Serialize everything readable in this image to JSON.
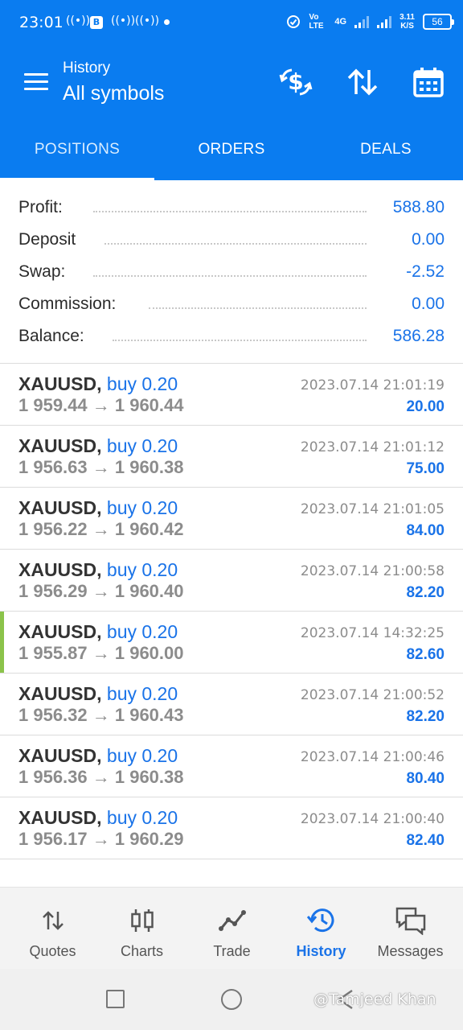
{
  "status_bar": {
    "time": "23:01",
    "signal_text": "4G",
    "volte_text": "Vo LTE",
    "net_speed": "3.11",
    "net_unit": "K/S",
    "battery": "56"
  },
  "app_bar": {
    "title_small": "History",
    "title_big": "All symbols"
  },
  "tabs": [
    {
      "label": "POSITIONS",
      "active": true
    },
    {
      "label": "ORDERS",
      "active": false
    },
    {
      "label": "DEALS",
      "active": false
    }
  ],
  "summary": {
    "profit": {
      "label": "Profit:",
      "value": "588.80"
    },
    "deposit": {
      "label": "Deposit",
      "value": "0.00"
    },
    "swap": {
      "label": "Swap:",
      "value": "-2.52"
    },
    "commission": {
      "label": "Commission:",
      "value": "0.00"
    },
    "balance": {
      "label": "Balance:",
      "value": "586.28"
    }
  },
  "deals": [
    {
      "symbol": "XAUUSD,",
      "side": "buy 0.20",
      "prices": "1 959.44 → 1 960.44",
      "time": "2023.07.14 21:01:19",
      "profit": "20.00",
      "highlight": false
    },
    {
      "symbol": "XAUUSD,",
      "side": "buy 0.20",
      "prices": "1 956.63 → 1 960.38",
      "time": "2023.07.14 21:01:12",
      "profit": "75.00",
      "highlight": false
    },
    {
      "symbol": "XAUUSD,",
      "side": "buy 0.20",
      "prices": "1 956.22 → 1 960.42",
      "time": "2023.07.14 21:01:05",
      "profit": "84.00",
      "highlight": false
    },
    {
      "symbol": "XAUUSD,",
      "side": "buy 0.20",
      "prices": "1 956.29 → 1 960.40",
      "time": "2023.07.14 21:00:58",
      "profit": "82.20",
      "highlight": false
    },
    {
      "symbol": "XAUUSD,",
      "side": "buy 0.20",
      "prices": "1 955.87 → 1 960.00",
      "time": "2023.07.14 14:32:25",
      "profit": "82.60",
      "highlight": true
    },
    {
      "symbol": "XAUUSD,",
      "side": "buy 0.20",
      "prices": "1 956.32 → 1 960.43",
      "time": "2023.07.14 21:00:52",
      "profit": "82.20",
      "highlight": false
    },
    {
      "symbol": "XAUUSD,",
      "side": "buy 0.20",
      "prices": "1 956.36 → 1 960.38",
      "time": "2023.07.14 21:00:46",
      "profit": "80.40",
      "highlight": false
    },
    {
      "symbol": "XAUUSD,",
      "side": "buy 0.20",
      "prices": "1 956.17 → 1 960.29",
      "time": "2023.07.14 21:00:40",
      "profit": "82.40",
      "highlight": false
    }
  ],
  "bottom_nav": [
    {
      "label": "Quotes",
      "icon": "quotes-icon",
      "active": false
    },
    {
      "label": "Charts",
      "icon": "charts-icon",
      "active": false
    },
    {
      "label": "Trade",
      "icon": "trade-icon",
      "active": false
    },
    {
      "label": "History",
      "icon": "history-icon",
      "active": true
    },
    {
      "label": "Messages",
      "icon": "messages-icon",
      "active": false
    }
  ],
  "watermark": "@Tamjeed Khan",
  "colors": {
    "primary": "#0a7cf0",
    "accent_text": "#1a73e8",
    "highlight_bar": "#8bc34a"
  }
}
